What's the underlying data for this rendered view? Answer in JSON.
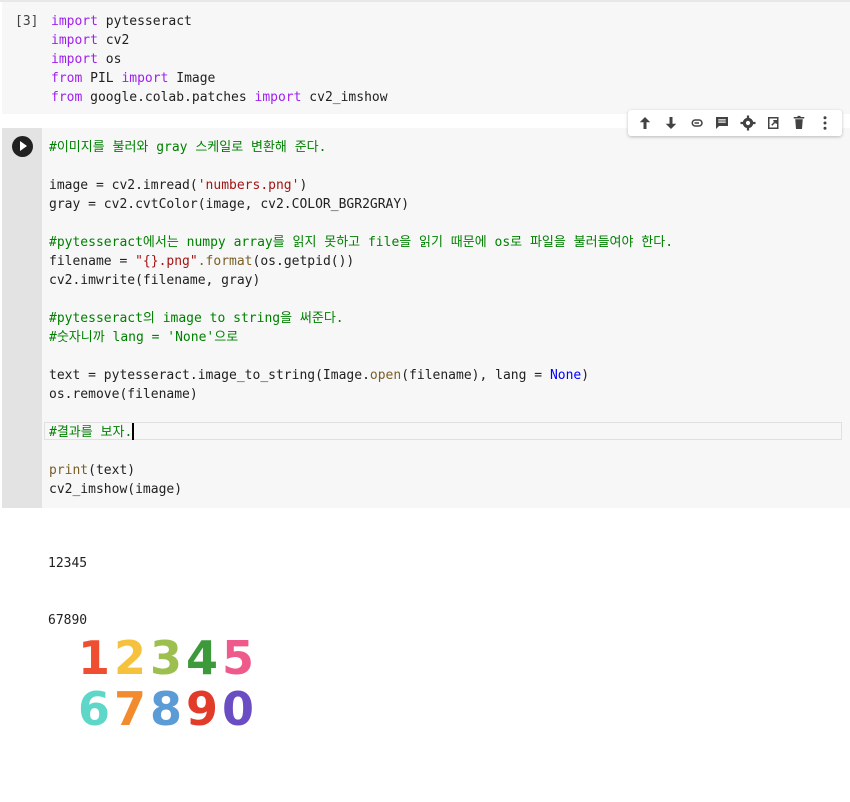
{
  "cell1": {
    "execution_count": "[3]",
    "lines": [
      [
        {
          "t": "import",
          "c": "kw"
        },
        {
          "t": " pytesseract",
          "c": "txt"
        }
      ],
      [
        {
          "t": "import",
          "c": "kw"
        },
        {
          "t": " cv2",
          "c": "txt"
        }
      ],
      [
        {
          "t": "import",
          "c": "kw"
        },
        {
          "t": " os",
          "c": "txt"
        }
      ],
      [
        {
          "t": "from",
          "c": "kw"
        },
        {
          "t": " PIL ",
          "c": "txt"
        },
        {
          "t": "import",
          "c": "kw"
        },
        {
          "t": " Image",
          "c": "txt"
        }
      ],
      [
        {
          "t": "from",
          "c": "kw"
        },
        {
          "t": " google.colab.patches ",
          "c": "txt"
        },
        {
          "t": "import",
          "c": "kw"
        },
        {
          "t": " cv2_imshow",
          "c": "txt"
        }
      ]
    ]
  },
  "cell2": {
    "lines": [
      [
        {
          "t": "#이미지를 불러와 gray 스케일로 변환해 준다.",
          "c": "cmt"
        }
      ],
      [],
      [
        {
          "t": "image = cv2.imread(",
          "c": "txt"
        },
        {
          "t": "'numbers.png'",
          "c": "str"
        },
        {
          "t": ")",
          "c": "txt"
        }
      ],
      [
        {
          "t": "gray = cv2.cvtColor(image, cv2.COLOR_BGR2GRAY)",
          "c": "txt"
        }
      ],
      [],
      [
        {
          "t": "#pytesseract에서는 numpy array를 읽지 못하고 file을 읽기 때문에 os로 파일을 불러들여야 한다.",
          "c": "cmt"
        }
      ],
      [
        {
          "t": "filename = ",
          "c": "txt"
        },
        {
          "t": "\"{}.png\"",
          "c": "str"
        },
        {
          "t": ".format",
          "c": "fn"
        },
        {
          "t": "(os.getpid())",
          "c": "txt"
        }
      ],
      [
        {
          "t": "cv2.imwrite(filename, gray)",
          "c": "txt"
        }
      ],
      [],
      [
        {
          "t": "#pytesseract의 image to string을 써준다.",
          "c": "cmt"
        }
      ],
      [
        {
          "t": "#숫자니까 lang = 'None'으로",
          "c": "cmt"
        }
      ],
      [],
      [
        {
          "t": "text = pytesseract.image_to_string(Image.",
          "c": "txt"
        },
        {
          "t": "open",
          "c": "fn"
        },
        {
          "t": "(filename), lang = ",
          "c": "txt"
        },
        {
          "t": "None",
          "c": "blue"
        },
        {
          "t": ")",
          "c": "txt"
        }
      ],
      [
        {
          "t": "os.remove(filename)",
          "c": "txt"
        }
      ],
      [],
      [
        {
          "t": "#결과를 보자.",
          "c": "cmt"
        }
      ],
      [],
      [
        {
          "t": "print",
          "c": "fn"
        },
        {
          "t": "(text)",
          "c": "txt"
        }
      ],
      [
        {
          "t": "cv2_imshow(image)",
          "c": "txt"
        }
      ]
    ]
  },
  "toolbar": {
    "buttons": [
      "move-up",
      "move-down",
      "link",
      "comment",
      "settings",
      "mirror-cell",
      "delete",
      "more"
    ]
  },
  "output": {
    "text_lines": [
      "12345",
      "67890"
    ]
  },
  "output_image": {
    "row1": [
      {
        "d": "1",
        "color": "#f04e31"
      },
      {
        "d": "2",
        "color": "#f6c23e"
      },
      {
        "d": "3",
        "color": "#9dbf4f"
      },
      {
        "d": "4",
        "color": "#3c9a3a"
      },
      {
        "d": "5",
        "color": "#ee5a8a"
      }
    ],
    "row2": [
      {
        "d": "6",
        "color": "#5fd7c8"
      },
      {
        "d": "7",
        "color": "#f28a2e"
      },
      {
        "d": "8",
        "color": "#5b9bd6"
      },
      {
        "d": "9",
        "color": "#e33b2a"
      },
      {
        "d": "0",
        "color": "#6a4cc3"
      }
    ]
  }
}
